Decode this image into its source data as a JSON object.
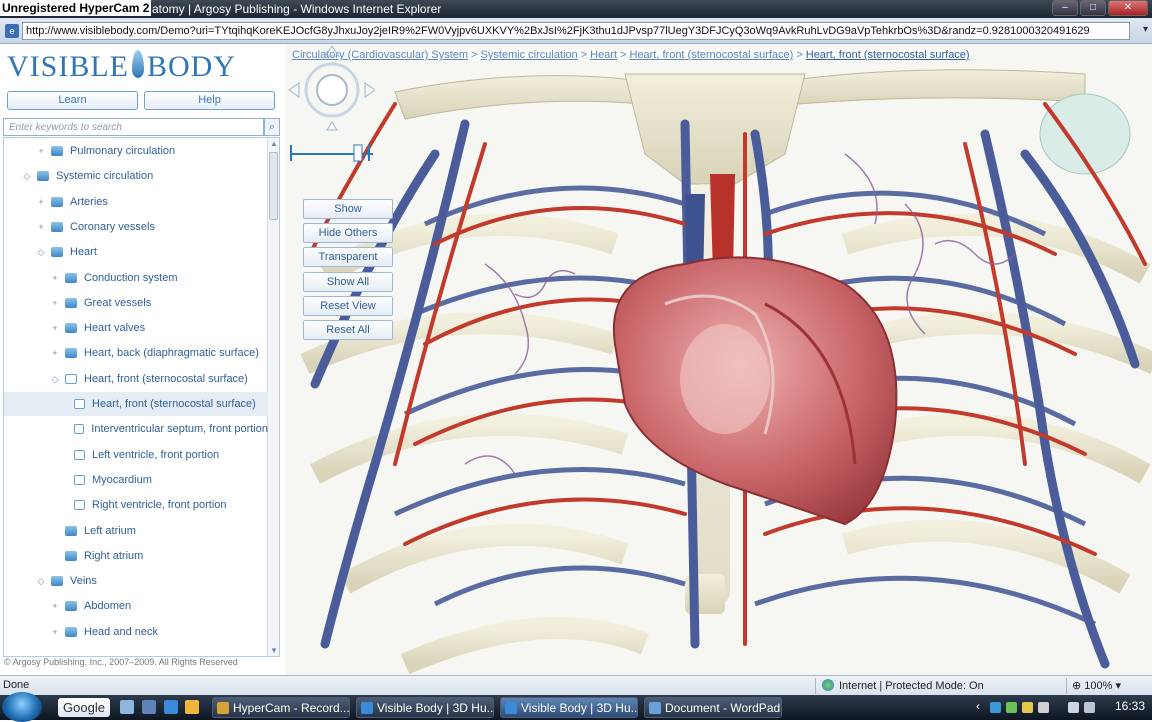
{
  "window": {
    "watermark": "Unregistered HyperCam 2",
    "title": "atomy | Argosy Publishing - Windows Internet Explorer",
    "minimize_glyph": "–",
    "maximize_glyph": "□",
    "close_glyph": "✕"
  },
  "address_bar": {
    "url": "http://www.visiblebody.com/Demo?uri=TYtqihqKoreKEJOcfG8yJhxuJoy2jeIR9%2FW0Vyjpv6UXKVY%2BxJsI%2FjK3thu1dJPvsp77lUegY3DFJCyQ3oWq9AvkRuhLvDG9aVpTehkrbOs%3D&randz=0.9281000320491629",
    "dropdown_glyph": "▾"
  },
  "sidebar": {
    "logo_left": "VISIBLE",
    "logo_right": "BODY",
    "learn_label": "Learn",
    "help_label": "Help",
    "search_placeholder": "Enter keywords to search",
    "search_icon_glyph": "🔍",
    "copyright": "© Argosy Publishing, Inc., 2007–2009. All Rights Reserved",
    "tree": [
      {
        "label": "Pulmonary circulation",
        "depth": 1,
        "expander": "+",
        "icon": "folder"
      },
      {
        "label": "Systemic circulation",
        "depth": 0,
        "expander": "◇",
        "icon": "folder"
      },
      {
        "label": "Arteries",
        "depth": 1,
        "expander": "+",
        "icon": "folder"
      },
      {
        "label": "Coronary vessels",
        "depth": 1,
        "expander": "+",
        "icon": "folder"
      },
      {
        "label": "Heart",
        "depth": 1,
        "expander": "◇",
        "icon": "folder"
      },
      {
        "label": "Conduction system",
        "depth": 2,
        "expander": "+",
        "icon": "folder"
      },
      {
        "label": "Great vessels",
        "depth": 2,
        "expander": "+",
        "icon": "folder"
      },
      {
        "label": "Heart valves",
        "depth": 2,
        "expander": "+",
        "icon": "folder"
      },
      {
        "label": "Heart, back (diaphragmatic surface)",
        "depth": 2,
        "expander": "+",
        "icon": "folder"
      },
      {
        "label": "Heart, front (sternocostal surface)",
        "depth": 2,
        "expander": "◇",
        "icon": "folder-open"
      },
      {
        "label": "Heart, front (sternocostal surface)",
        "depth": 3,
        "expander": "",
        "icon": "page",
        "selected": true
      },
      {
        "label": "Interventricular septum, front portion",
        "depth": 3,
        "expander": "",
        "icon": "page"
      },
      {
        "label": "Left ventricle, front portion",
        "depth": 3,
        "expander": "",
        "icon": "page"
      },
      {
        "label": "Myocardium",
        "depth": 3,
        "expander": "",
        "icon": "page"
      },
      {
        "label": "Right ventricle, front portion",
        "depth": 3,
        "expander": "",
        "icon": "page"
      },
      {
        "label": "Left atrium",
        "depth": 2,
        "expander": "",
        "icon": "folder"
      },
      {
        "label": "Right atrium",
        "depth": 2,
        "expander": "",
        "icon": "folder"
      },
      {
        "label": "Veins",
        "depth": 1,
        "expander": "◇",
        "icon": "folder"
      },
      {
        "label": "Abdomen",
        "depth": 2,
        "expander": "+",
        "icon": "folder"
      },
      {
        "label": "Head and neck",
        "depth": 2,
        "expander": "+",
        "icon": "folder"
      }
    ]
  },
  "breadcrumb": [
    "Circulatory (Cardiovascular) System",
    "Systemic circulation",
    "Heart",
    "Heart, front (sternocostal surface)",
    "Heart, front (sternocostal surface)"
  ],
  "breadcrumb_sep": ">",
  "controls": {
    "show": "Show",
    "hide_others": "Hide Others",
    "transparent": "Transparent",
    "show_all": "Show All",
    "reset_view": "Reset View",
    "reset_all": "Reset All"
  },
  "statusbar": {
    "status": "Done",
    "zone": "Internet | Protected Mode: On",
    "zoom": "100%",
    "zoom_dd": "▾"
  },
  "taskbar": {
    "google": "Google",
    "tasks": [
      {
        "label": "HyperCam - Record...",
        "active": false
      },
      {
        "label": "Visible Body | 3D Hu...",
        "active": false
      },
      {
        "label": "Visible Body | 3D Hu...",
        "active": true
      },
      {
        "label": "Document - WordPad",
        "active": false
      }
    ],
    "clock": "16:33",
    "tray_chevron": "‹"
  },
  "colors": {
    "artery": "#c23a2b",
    "vein": "#4a5d9a",
    "bone": "#e4e0c9",
    "heart": "#c9666a",
    "accent": "#2f76b8"
  }
}
